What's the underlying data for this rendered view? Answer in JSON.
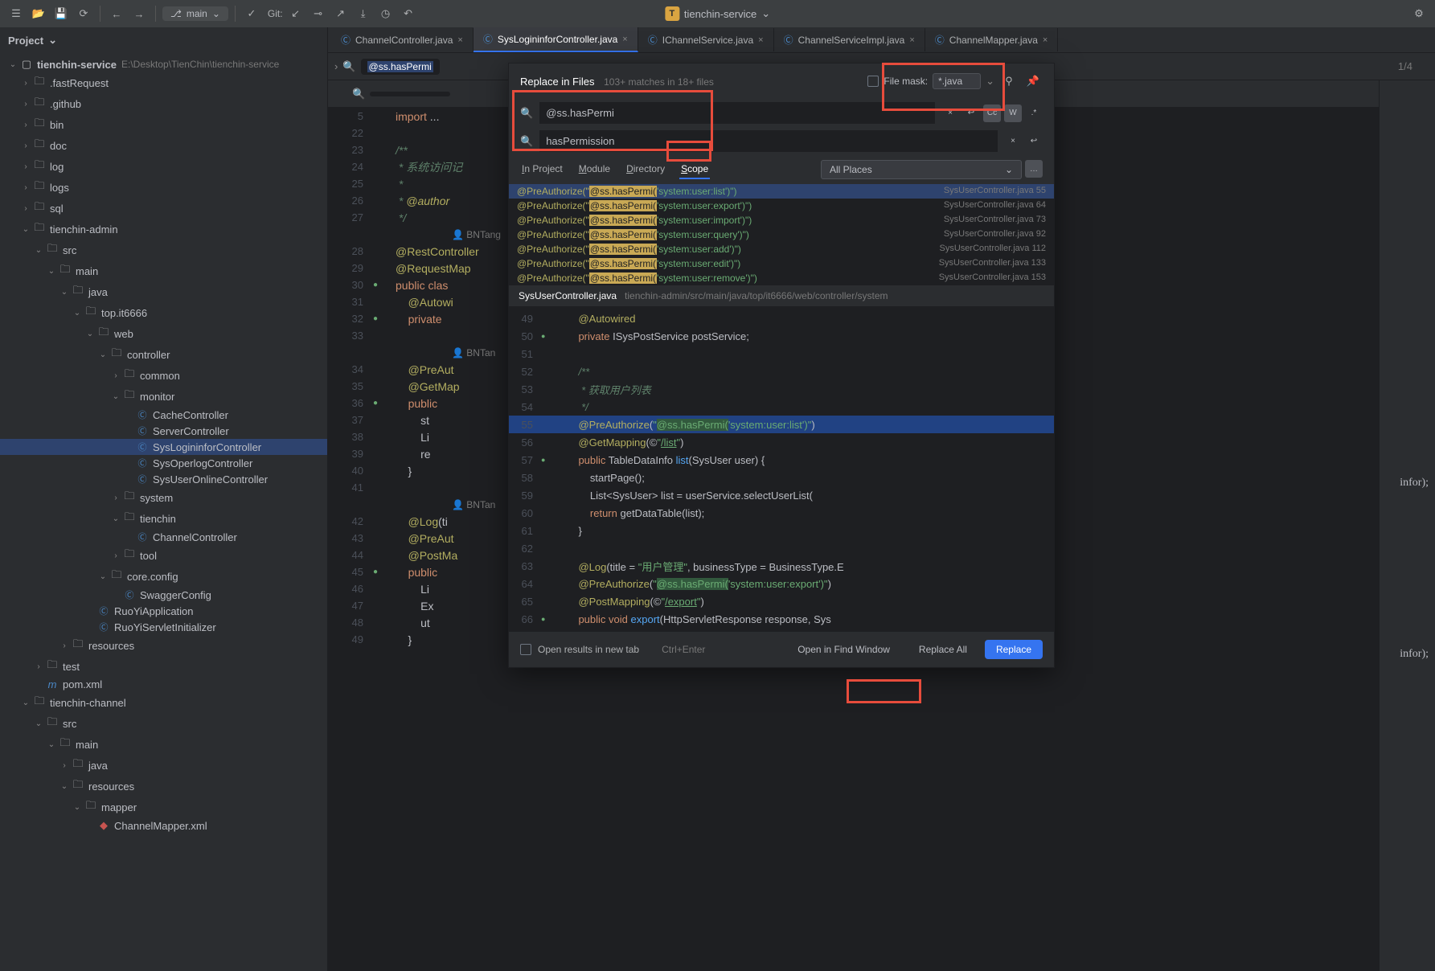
{
  "toolbar": {
    "branch": "main",
    "git_label": "Git:",
    "project_name": "tienchin-service",
    "t_badge": "T"
  },
  "sidebar": {
    "header": "Project",
    "root": "tienchin-service",
    "root_path": "E:\\Desktop\\TienChin\\tienchin-service",
    "items": [
      {
        "indent": 1,
        "arrow": "›",
        "type": "folder",
        "label": ".fastRequest"
      },
      {
        "indent": 1,
        "arrow": "›",
        "type": "folder",
        "label": ".github"
      },
      {
        "indent": 1,
        "arrow": "›",
        "type": "folder",
        "label": "bin"
      },
      {
        "indent": 1,
        "arrow": "›",
        "type": "folder",
        "label": "doc"
      },
      {
        "indent": 1,
        "arrow": "›",
        "type": "folder",
        "label": "log"
      },
      {
        "indent": 1,
        "arrow": "›",
        "type": "folder",
        "label": "logs"
      },
      {
        "indent": 1,
        "arrow": "›",
        "type": "folder",
        "label": "sql"
      },
      {
        "indent": 1,
        "arrow": "⌄",
        "type": "module",
        "label": "tienchin-admin"
      },
      {
        "indent": 2,
        "arrow": "⌄",
        "type": "folder",
        "label": "src"
      },
      {
        "indent": 3,
        "arrow": "⌄",
        "type": "folder",
        "label": "main"
      },
      {
        "indent": 4,
        "arrow": "⌄",
        "type": "src",
        "label": "java"
      },
      {
        "indent": 5,
        "arrow": "⌄",
        "type": "pkg",
        "label": "top.it6666"
      },
      {
        "indent": 6,
        "arrow": "⌄",
        "type": "pkg",
        "label": "web"
      },
      {
        "indent": 7,
        "arrow": "⌄",
        "type": "pkg",
        "label": "controller"
      },
      {
        "indent": 8,
        "arrow": "›",
        "type": "pkg",
        "label": "common"
      },
      {
        "indent": 8,
        "arrow": "⌄",
        "type": "pkg",
        "label": "monitor"
      },
      {
        "indent": 9,
        "arrow": "",
        "type": "class",
        "label": "CacheController"
      },
      {
        "indent": 9,
        "arrow": "",
        "type": "class",
        "label": "ServerController"
      },
      {
        "indent": 9,
        "arrow": "",
        "type": "class",
        "label": "SysLogininforController",
        "selected": true
      },
      {
        "indent": 9,
        "arrow": "",
        "type": "class",
        "label": "SysOperlogController"
      },
      {
        "indent": 9,
        "arrow": "",
        "type": "class",
        "label": "SysUserOnlineController"
      },
      {
        "indent": 8,
        "arrow": "›",
        "type": "pkg",
        "label": "system"
      },
      {
        "indent": 8,
        "arrow": "⌄",
        "type": "pkg",
        "label": "tienchin"
      },
      {
        "indent": 9,
        "arrow": "",
        "type": "class",
        "label": "ChannelController"
      },
      {
        "indent": 8,
        "arrow": "›",
        "type": "pkg",
        "label": "tool"
      },
      {
        "indent": 7,
        "arrow": "⌄",
        "type": "pkg",
        "label": "core.config"
      },
      {
        "indent": 8,
        "arrow": "",
        "type": "class",
        "label": "SwaggerConfig"
      },
      {
        "indent": 6,
        "arrow": "",
        "type": "class",
        "label": "RuoYiApplication"
      },
      {
        "indent": 6,
        "arrow": "",
        "type": "class",
        "label": "RuoYiServletInitializer"
      },
      {
        "indent": 4,
        "arrow": "›",
        "type": "res",
        "label": "resources"
      },
      {
        "indent": 2,
        "arrow": "›",
        "type": "folder",
        "label": "test"
      },
      {
        "indent": 2,
        "arrow": "",
        "type": "maven",
        "label": "pom.xml"
      },
      {
        "indent": 1,
        "arrow": "⌄",
        "type": "module",
        "label": "tienchin-channel"
      },
      {
        "indent": 2,
        "arrow": "⌄",
        "type": "folder",
        "label": "src"
      },
      {
        "indent": 3,
        "arrow": "⌄",
        "type": "folder",
        "label": "main"
      },
      {
        "indent": 4,
        "arrow": "›",
        "type": "src",
        "label": "java"
      },
      {
        "indent": 4,
        "arrow": "⌄",
        "type": "res",
        "label": "resources"
      },
      {
        "indent": 5,
        "arrow": "⌄",
        "type": "folder",
        "label": "mapper"
      },
      {
        "indent": 6,
        "arrow": "",
        "type": "xml",
        "label": "ChannelMapper.xml"
      }
    ]
  },
  "tabs": [
    {
      "label": "ChannelController.java",
      "active": false
    },
    {
      "label": "SysLogininforController.java",
      "active": true
    },
    {
      "label": "IChannelService.java",
      "active": false
    },
    {
      "label": "ChannelServiceImpl.java",
      "active": false
    },
    {
      "label": "ChannelMapper.java",
      "active": false
    }
  ],
  "search_bar": {
    "text": "@ss.hasPermi",
    "count": "1/4"
  },
  "editor_lines": [
    {
      "n": "5",
      "cls": "",
      "hint": "",
      "code": "<span class='kw'>import</span> ..."
    },
    {
      "n": "22",
      "code": ""
    },
    {
      "n": "23",
      "code": "<span class='com'>/**</span>"
    },
    {
      "n": "24",
      "code": "<span class='com'> * 系统访问记</span>"
    },
    {
      "n": "25",
      "code": "<span class='com'> *</span>"
    },
    {
      "n": "26",
      "code": "<span class='com'> * <span class='ann'>@author</span></span>"
    },
    {
      "n": "27",
      "code": "<span class='com'> */</span>"
    },
    {
      "n": "",
      "author": "BNTang"
    },
    {
      "n": "28",
      "code": "<span class='ann'>@RestController</span>"
    },
    {
      "n": "29",
      "code": "<span class='ann'>@RequestMap</span>"
    },
    {
      "n": "30",
      "icons": "RG",
      "code": "<span class='kw'>public clas</span>"
    },
    {
      "n": "31",
      "code": "    <span class='ann'>@Autowi</span>"
    },
    {
      "n": "32",
      "icons": "G",
      "code": "    <span class='kw'>private</span>"
    },
    {
      "n": "33",
      "code": ""
    },
    {
      "n": "",
      "author": "BNTan"
    },
    {
      "n": "34",
      "code": "    <span class='ann'>@PreAut</span>"
    },
    {
      "n": "35",
      "code": "    <span class='ann'>@GetMap</span>"
    },
    {
      "n": "36",
      "icons": "fw",
      "code": "    <span class='kw'>public</span>"
    },
    {
      "n": "37",
      "code": "        st"
    },
    {
      "n": "38",
      "code": "        Li"
    },
    {
      "n": "39",
      "code": "        re"
    },
    {
      "n": "40",
      "code": "    }"
    },
    {
      "n": "41",
      "code": ""
    },
    {
      "n": "",
      "author": "BNTan"
    },
    {
      "n": "42",
      "code": "    <span class='ann'>@Log</span>(ti"
    },
    {
      "n": "43",
      "code": "    <span class='ann'>@PreAut</span>"
    },
    {
      "n": "44",
      "code": "    <span class='ann'>@PostMa</span>"
    },
    {
      "n": "45",
      "icons": "fGG",
      "code": "    <span class='kw'>public</span>"
    },
    {
      "n": "46",
      "code": "        Li"
    },
    {
      "n": "47",
      "code": "        Ex"
    },
    {
      "n": "48",
      "code": "        ut"
    },
    {
      "n": "49",
      "code": "    }"
    }
  ],
  "dialog": {
    "title": "Replace in Files",
    "matches": "103+ matches in 18+ files",
    "file_mask_label": "File mask:",
    "file_mask_value": "*.java",
    "search_value": "@ss.hasPermi",
    "replace_value": "hasPermission",
    "cc": "Cc",
    "w": "W",
    "regex": ".*",
    "tabs": [
      "In Project",
      "Module",
      "Directory",
      "Scope"
    ],
    "active_tab": 3,
    "scope_value": "All Places",
    "results": [
      {
        "pre": "@PreAuthorize(\"",
        "hl": "@ss.hasPermi(",
        "post": "'system:user:list')\")",
        "loc": "SysUserController.java 55",
        "sel": true
      },
      {
        "pre": "@PreAuthorize(\"",
        "hl": "@ss.hasPermi(",
        "post": "'system:user:export')\")",
        "loc": "SysUserController.java 64"
      },
      {
        "pre": "@PreAuthorize(\"",
        "hl": "@ss.hasPermi(",
        "post": "'system:user:import')\")",
        "loc": "SysUserController.java 73"
      },
      {
        "pre": "@PreAuthorize(\"",
        "hl": "@ss.hasPermi(",
        "post": "'system:user:query')\")",
        "loc": "SysUserController.java 92"
      },
      {
        "pre": "@PreAuthorize(\"",
        "hl": "@ss.hasPermi(",
        "post": "'system:user:add')\")",
        "loc": "SysUserController.java 112"
      },
      {
        "pre": "@PreAuthorize(\"",
        "hl": "@ss.hasPermi(",
        "post": "'system:user:edit')\")",
        "loc": "SysUserController.java 133"
      },
      {
        "pre": "@PreAuthorize(\"",
        "hl": "@ss.hasPermi(",
        "post": "'system:user:remove')\")",
        "loc": "SysUserController.java 153"
      }
    ],
    "preview_file": "SysUserController.java",
    "preview_path": "tienchin-admin/src/main/java/top/it6666/web/controller/system",
    "preview_lines": [
      {
        "n": "49",
        "code": "    <span class='ann'>@Autowired</span>"
      },
      {
        "n": "50",
        "icons": "G",
        "code": "    <span class='kw'>private</span> ISysPostService postService;"
      },
      {
        "n": "51",
        "code": ""
      },
      {
        "n": "52",
        "code": "    <span class='com'>/**</span>"
      },
      {
        "n": "53",
        "code": "    <span class='com'> * 获取用户列表</span>"
      },
      {
        "n": "54",
        "code": "    <span class='com'> */</span>"
      },
      {
        "n": "55",
        "sel": true,
        "code": "    <span class='ann'>@PreAuthorize</span>(<span class='str'>\"<span class='match-hl'>@ss.hasPermi(</span>'system:user:list'<span class='sel-hl'>)</span>\"</span>)"
      },
      {
        "n": "56",
        "code": "    <span class='ann'>@GetMapping</span>(©<span class='str'>\"<u>/list</u>\"</span>)"
      },
      {
        "n": "57",
        "icons": "fG",
        "code": "    <span class='kw'>public</span> TableDataInfo <span class='fn'>list</span>(SysUser user) {"
      },
      {
        "n": "58",
        "code": "        startPage();"
      },
      {
        "n": "59",
        "code": "        List&lt;SysUser&gt; list = userService.selectUserList("
      },
      {
        "n": "60",
        "code": "        <span class='kw'>return</span> getDataTable(list);"
      },
      {
        "n": "61",
        "code": "    }"
      },
      {
        "n": "62",
        "code": ""
      },
      {
        "n": "63",
        "code": "    <span class='ann'>@Log</span>(title = <span class='str'>\"用户管理\"</span>, businessType = BusinessType.<span class='type'>E</span>"
      },
      {
        "n": "64",
        "code": "    <span class='ann'>@PreAuthorize</span>(<span class='str'>\"<span class='match-hl'>@ss.hasPermi(</span>'system:user:export')\"</span>)"
      },
      {
        "n": "65",
        "code": "    <span class='ann'>@PostMapping</span>(©<span class='str'>\"<u>/export</u>\"</span>)"
      },
      {
        "n": "66",
        "icons": "fGG",
        "code": "    <span class='kw'>public void</span> <span class='fn'>export</span>(HttpServletResponse response, Sys"
      }
    ],
    "footer": {
      "open_tab": "Open results in new tab",
      "hint": "Ctrl+Enter",
      "open_find": "Open in Find Window",
      "replace_all": "Replace All",
      "replace": "Replace"
    }
  },
  "right_hint1": "infor);",
  "right_hint2": "infor);"
}
